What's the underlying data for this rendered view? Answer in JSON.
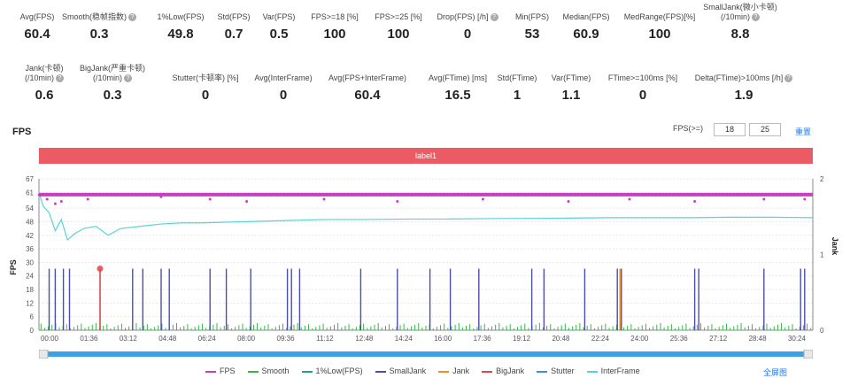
{
  "metrics_row1": [
    {
      "label": "Avg(FPS)",
      "value": "60.4",
      "help": false
    },
    {
      "label": "Smooth(稳帧指数)",
      "value": "0.3",
      "help": true
    },
    {
      "label": "1%Low(FPS)",
      "value": "49.8",
      "help": false
    },
    {
      "label": "Std(FPS)",
      "value": "0.7",
      "help": false
    },
    {
      "label": "Var(FPS)",
      "value": "0.5",
      "help": false
    },
    {
      "label": "FPS>=18 [%]",
      "value": "100",
      "help": false
    },
    {
      "label": "FPS>=25 [%]",
      "value": "100",
      "help": false
    },
    {
      "label": "Drop(FPS) [/h]",
      "value": "0",
      "help": true
    },
    {
      "label": "Min(FPS)",
      "value": "53",
      "help": false
    },
    {
      "label": "Median(FPS)",
      "value": "60.9",
      "help": false
    },
    {
      "label": "MedRange(FPS)[%]",
      "value": "100",
      "help": false
    },
    {
      "label": "SmallJank(微小卡顿)\n(/10min)",
      "value": "8.8",
      "help": true
    }
  ],
  "metrics_row2": [
    {
      "label": "Jank(卡顿)\n(/10min)",
      "value": "0.6",
      "help": true
    },
    {
      "label": "BigJank(严重卡顿)\n(/10min)",
      "value": "0.3",
      "help": true
    },
    {
      "label": "Stutter(卡顿率) [%]",
      "value": "0",
      "help": false
    },
    {
      "label": "Avg(InterFrame)",
      "value": "0",
      "help": false
    },
    {
      "label": "Avg(FPS+InterFrame)",
      "value": "60.4",
      "help": false
    },
    {
      "label": "Avg(FTime) [ms]",
      "value": "16.5",
      "help": false
    },
    {
      "label": "Std(FTime)",
      "value": "1",
      "help": false
    },
    {
      "label": "Var(FTime)",
      "value": "1.1",
      "help": false
    },
    {
      "label": "FTime>=100ms [%]",
      "value": "0",
      "help": false
    },
    {
      "label": "Delta(FTime)>100ms [/h]",
      "value": "1.9",
      "help": true
    }
  ],
  "section_title": "FPS",
  "fps_filter": {
    "label": "FPS(>=)",
    "value1": "18",
    "value2": "25",
    "reset": "重置"
  },
  "label_bar": "label1",
  "chart_data": {
    "type": "line",
    "ylabel": "FPS",
    "y2label": "Jank",
    "yticks": [
      0,
      6,
      12,
      18,
      24,
      30,
      36,
      42,
      48,
      54,
      61,
      67
    ],
    "y2ticks": [
      0,
      1,
      2
    ],
    "xticks": [
      "00:00",
      "01:36",
      "03:12",
      "04:48",
      "06:24",
      "08:00",
      "09:36",
      "11:12",
      "12:48",
      "14:24",
      "16:00",
      "17:36",
      "19:12",
      "20:48",
      "22:24",
      "24:00",
      "25:36",
      "27:12",
      "28:48",
      "30:24"
    ],
    "x_range_seconds": [
      0,
      1900
    ],
    "fps_level": 60,
    "fps_low_dips": [
      [
        20,
        58
      ],
      [
        40,
        56
      ],
      [
        55,
        57
      ],
      [
        120,
        58
      ],
      [
        300,
        59
      ],
      [
        420,
        58
      ],
      [
        510,
        57
      ],
      [
        700,
        58
      ],
      [
        880,
        57
      ],
      [
        1090,
        58
      ],
      [
        1300,
        57
      ],
      [
        1450,
        58
      ],
      [
        1610,
        57
      ],
      [
        1780,
        58
      ],
      [
        1880,
        58
      ]
    ],
    "interframe": [
      [
        0,
        61
      ],
      [
        10,
        55
      ],
      [
        25,
        52
      ],
      [
        40,
        44
      ],
      [
        55,
        49
      ],
      [
        70,
        40
      ],
      [
        90,
        43
      ],
      [
        110,
        45
      ],
      [
        140,
        46
      ],
      [
        170,
        42
      ],
      [
        200,
        45
      ],
      [
        250,
        46
      ],
      [
        300,
        47
      ],
      [
        350,
        47.5
      ],
      [
        400,
        47.5
      ],
      [
        500,
        48
      ],
      [
        600,
        48.5
      ],
      [
        700,
        49
      ],
      [
        800,
        49
      ],
      [
        900,
        49.2
      ],
      [
        1000,
        49.2
      ],
      [
        1100,
        49.4
      ],
      [
        1200,
        49.5
      ],
      [
        1300,
        49.6
      ],
      [
        1400,
        49.8
      ],
      [
        1500,
        49.8
      ],
      [
        1600,
        49.8
      ],
      [
        1700,
        50
      ],
      [
        1800,
        50
      ],
      [
        1900,
        49.8
      ]
    ],
    "smalljank_seconds": [
      25,
      40,
      60,
      75,
      230,
      255,
      300,
      320,
      420,
      460,
      520,
      610,
      620,
      640,
      790,
      880,
      960,
      1010,
      1080,
      1210,
      1240,
      1340,
      1420,
      1430,
      1610,
      1620,
      1780,
      1870,
      1880
    ],
    "jank_seconds": [
      1420,
      1430
    ],
    "bigjank_seconds": [
      150
    ],
    "legend": [
      {
        "name": "FPS",
        "color": "#c83fc0"
      },
      {
        "name": "Smooth",
        "color": "#3cb34a"
      },
      {
        "name": "1%Low(FPS)",
        "color": "#1fa38b"
      },
      {
        "name": "SmallJank",
        "color": "#4d4db0"
      },
      {
        "name": "Jank",
        "color": "#f08a2a"
      },
      {
        "name": "BigJank",
        "color": "#e04848"
      },
      {
        "name": "Stutter",
        "color": "#3c8fd8"
      },
      {
        "name": "InterFrame",
        "color": "#59d3d3"
      }
    ]
  },
  "fullscreen": "全屏图"
}
